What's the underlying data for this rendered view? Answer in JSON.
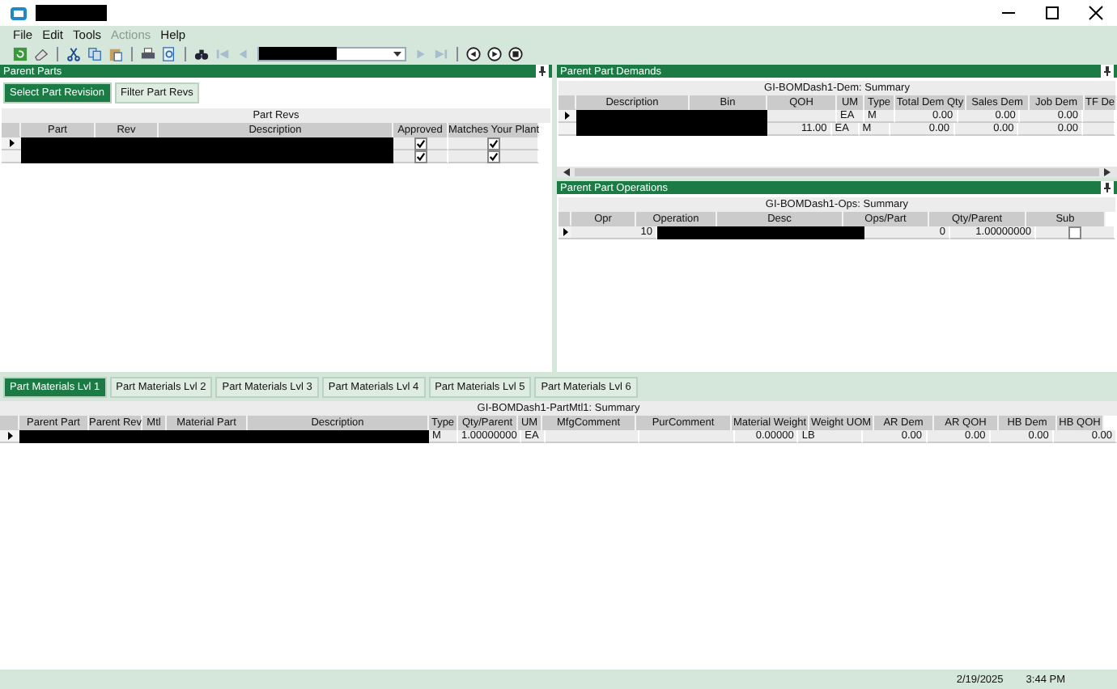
{
  "window": {
    "title_redacted": true
  },
  "menu": [
    {
      "label": "File",
      "disabled": false
    },
    {
      "label": "Edit",
      "disabled": false
    },
    {
      "label": "Tools",
      "disabled": false
    },
    {
      "label": "Actions",
      "disabled": true
    },
    {
      "label": "Help",
      "disabled": false
    }
  ],
  "toolbar": [
    {
      "kind": "refresh",
      "disabled": false
    },
    {
      "kind": "eraser",
      "disabled": false
    },
    {
      "kind": "separator"
    },
    {
      "kind": "cut",
      "disabled": false
    },
    {
      "kind": "copy",
      "disabled": false
    },
    {
      "kind": "paste",
      "disabled": false
    },
    {
      "kind": "separator"
    },
    {
      "kind": "print",
      "disabled": false
    },
    {
      "kind": "preview",
      "disabled": false
    },
    {
      "kind": "separator"
    },
    {
      "kind": "binoculars",
      "disabled": false
    },
    {
      "kind": "first",
      "disabled": true
    },
    {
      "kind": "prev",
      "disabled": true
    },
    {
      "kind": "combo",
      "value_redacted": true
    },
    {
      "kind": "next",
      "disabled": true
    },
    {
      "kind": "last",
      "disabled": true
    },
    {
      "kind": "separator"
    },
    {
      "kind": "back",
      "disabled": false
    },
    {
      "kind": "forward",
      "disabled": false
    },
    {
      "kind": "stop",
      "disabled": false
    }
  ],
  "parent_parts": {
    "title": "Parent Parts",
    "tabs": [
      {
        "label": "Select Part Revision",
        "selected": true
      },
      {
        "label": "Filter Part Revs",
        "selected": false
      }
    ],
    "grid": {
      "caption": "Part Revs",
      "columns": [
        "Part",
        "Rev",
        "Description",
        "Approved",
        "Matches Your Plant"
      ],
      "rows": [
        {
          "selected": true,
          "cells": [
            {
              "kind": "redacted"
            },
            {
              "kind": "redacted"
            },
            {
              "kind": "redacted"
            },
            {
              "kind": "check",
              "checked": true
            },
            {
              "kind": "check",
              "checked": true
            }
          ]
        },
        {
          "selected": false,
          "cells": [
            {
              "kind": "redacted"
            },
            {
              "kind": "redacted"
            },
            {
              "kind": "redacted"
            },
            {
              "kind": "check",
              "checked": true
            },
            {
              "kind": "check",
              "checked": true
            }
          ]
        }
      ]
    }
  },
  "parent_part_demands": {
    "title": "Parent Part Demands",
    "grid": {
      "caption": "GI-BOMDash1-Dem: Summary",
      "columns": [
        "Description",
        "Bin",
        "QOH",
        "UM",
        "Type",
        "Total Dem Qty",
        "Sales Dem",
        "Job Dem",
        "TF De"
      ],
      "rows": [
        {
          "selected": true,
          "cells": [
            {
              "kind": "redacted"
            },
            {
              "kind": "redacted"
            },
            {
              "kind": "empty"
            },
            {
              "kind": "text",
              "text": "EA"
            },
            {
              "kind": "text",
              "text": "M"
            },
            {
              "kind": "text",
              "text": "0.00"
            },
            {
              "kind": "text",
              "text": "0.00"
            },
            {
              "kind": "text",
              "text": "0.00"
            },
            {
              "kind": "empty"
            }
          ]
        },
        {
          "selected": false,
          "cells": [
            {
              "kind": "redacted"
            },
            {
              "kind": "redacted"
            },
            {
              "kind": "text",
              "text": "11.00"
            },
            {
              "kind": "text",
              "text": "EA"
            },
            {
              "kind": "text",
              "text": "M"
            },
            {
              "kind": "text",
              "text": "0.00"
            },
            {
              "kind": "text",
              "text": "0.00"
            },
            {
              "kind": "text",
              "text": "0.00"
            },
            {
              "kind": "empty"
            }
          ]
        }
      ]
    }
  },
  "parent_part_operations": {
    "title": "Parent Part Operations",
    "grid": {
      "caption": "GI-BOMDash1-Ops: Summary",
      "columns": [
        "Opr",
        "Operation",
        "Desc",
        "Ops/Part",
        "Qty/Parent",
        "Sub"
      ],
      "rows": [
        {
          "selected": true,
          "cells": [
            {
              "kind": "text",
              "text": "10"
            },
            {
              "kind": "redacted"
            },
            {
              "kind": "redacted"
            },
            {
              "kind": "text",
              "text": "0"
            },
            {
              "kind": "text",
              "text": "1.00000000"
            },
            {
              "kind": "check",
              "checked": false
            }
          ]
        }
      ]
    }
  },
  "part_materials": {
    "tabs": [
      {
        "label": "Part Materials Lvl 1",
        "selected": true
      },
      {
        "label": "Part Materials Lvl 2",
        "selected": false
      },
      {
        "label": "Part Materials Lvl 3",
        "selected": false
      },
      {
        "label": "Part Materials Lvl 4",
        "selected": false
      },
      {
        "label": "Part Materials Lvl 5",
        "selected": false
      },
      {
        "label": "Part Materials Lvl 6",
        "selected": false
      }
    ],
    "grid": {
      "caption": "GI-BOMDash1-PartMtl1: Summary",
      "columns": [
        "Parent Part",
        "Parent Rev",
        "Mtl",
        "Material Part",
        "Description",
        "Type",
        "Qty/Parent",
        "UM",
        "MfgComment",
        "PurComment",
        "Material Weight",
        "Weight UOM",
        "AR Dem",
        "AR QOH",
        "HB Dem",
        "HB QOH"
      ],
      "rows": [
        {
          "selected": true,
          "cells": [
            {
              "kind": "redacted"
            },
            {
              "kind": "redacted"
            },
            {
              "kind": "redacted"
            },
            {
              "kind": "redacted"
            },
            {
              "kind": "redacted"
            },
            {
              "kind": "text",
              "text": "M"
            },
            {
              "kind": "text",
              "text": "1.00000000"
            },
            {
              "kind": "text",
              "text": "EA"
            },
            {
              "kind": "empty"
            },
            {
              "kind": "empty"
            },
            {
              "kind": "text",
              "text": "0.00000"
            },
            {
              "kind": "text",
              "text": "LB"
            },
            {
              "kind": "text",
              "text": "0.00"
            },
            {
              "kind": "text",
              "text": "0.00"
            },
            {
              "kind": "text",
              "text": "0.00"
            },
            {
              "kind": "text",
              "text": "0.00"
            }
          ]
        }
      ]
    }
  },
  "status_bar": {
    "date": "2/19/2025",
    "time": "3:44 PM"
  }
}
